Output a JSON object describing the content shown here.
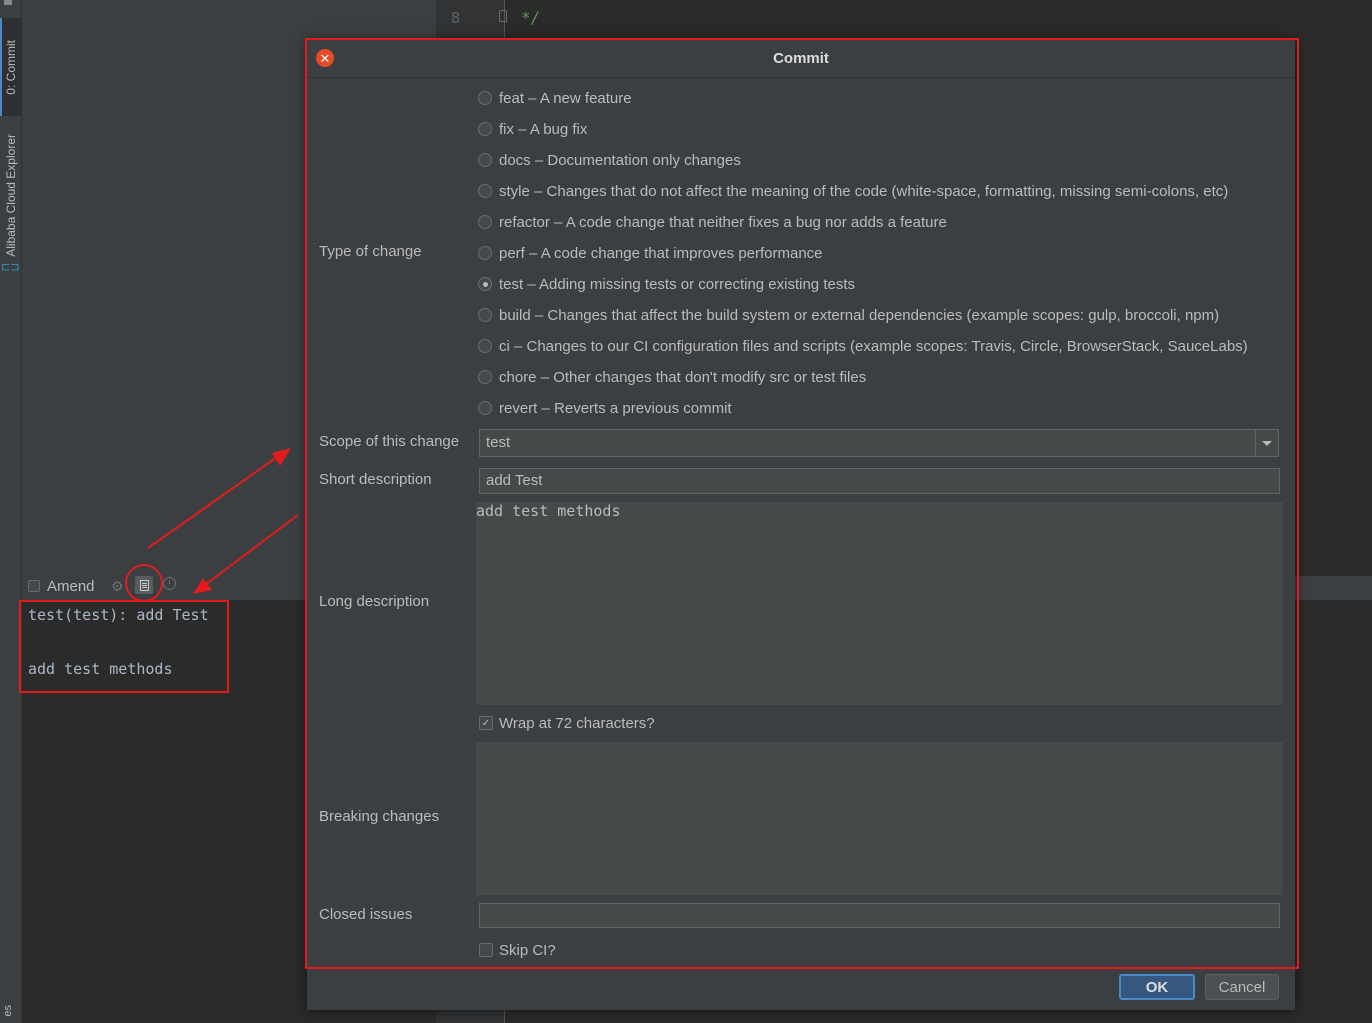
{
  "tool_stripe": {
    "commit_tab": "0: Commit",
    "cloud_tab": "Alibaba Cloud Explorer",
    "bottom_tab": "es"
  },
  "commit_panel": {
    "amend_label": "Amend",
    "amend_checked": false,
    "message_line1": "test(test): add Test",
    "message_line2": "add test methods"
  },
  "editor": {
    "line_number": "8",
    "code": "*/"
  },
  "dialog": {
    "title": "Commit",
    "labels": {
      "type": "Type of change",
      "scope": "Scope of this change",
      "short": "Short description",
      "long": "Long description",
      "breaking": "Breaking changes",
      "closed": "Closed issues"
    },
    "types": [
      {
        "text": "feat – A new feature",
        "selected": false
      },
      {
        "text": "fix – A bug fix",
        "selected": false
      },
      {
        "text": "docs – Documentation only changes",
        "selected": false
      },
      {
        "text": "style – Changes that do not affect the meaning of the code (white-space, formatting, missing semi-colons, etc)",
        "selected": false
      },
      {
        "text": "refactor – A code change that neither fixes a bug nor adds a feature",
        "selected": false
      },
      {
        "text": "perf – A code change that improves performance",
        "selected": false
      },
      {
        "text": "test – Adding missing tests or correcting existing tests",
        "selected": true
      },
      {
        "text": "build – Changes that affect the build system or external dependencies (example scopes: gulp, broccoli, npm)",
        "selected": false
      },
      {
        "text": "ci – Changes to our CI configuration files and scripts (example scopes: Travis, Circle, BrowserStack, SauceLabs)",
        "selected": false
      },
      {
        "text": "chore – Other changes that don't modify src or test files",
        "selected": false
      },
      {
        "text": "revert – Reverts a previous commit",
        "selected": false
      }
    ],
    "scope_value": "test",
    "short_description": "add Test",
    "long_description": "add test methods",
    "wrap_label": "Wrap at 72 characters?",
    "wrap_checked": true,
    "breaking_changes": "",
    "closed_issues": "",
    "skip_ci_label": "Skip CI?",
    "skip_ci_checked": false,
    "ok_label": "OK",
    "cancel_label": "Cancel"
  },
  "colors": {
    "annotation_red": "#e51b1b",
    "accent_blue": "#4a88c7",
    "close_button": "#e64a24"
  }
}
